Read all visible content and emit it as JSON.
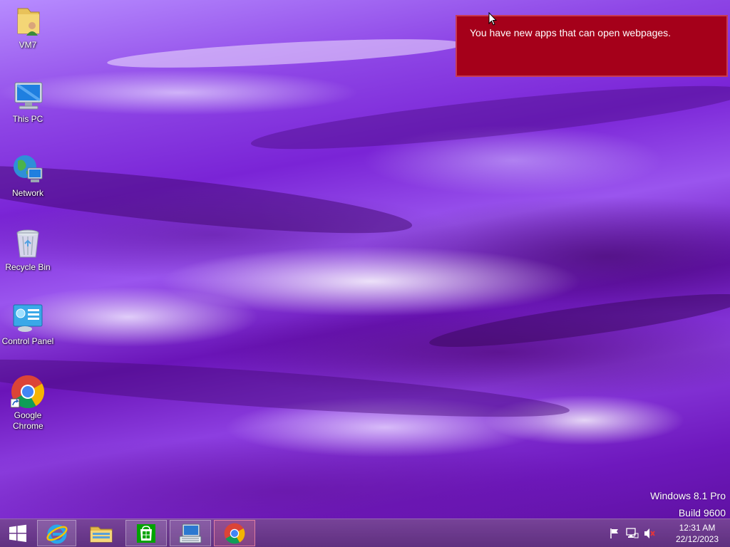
{
  "desktop": {
    "icons": [
      {
        "label": "VM7",
        "icon": "user-folder-icon"
      },
      {
        "label": "This PC",
        "icon": "this-pc-icon"
      },
      {
        "label": "Network",
        "icon": "network-icon"
      },
      {
        "label": "Recycle Bin",
        "icon": "recycle-bin-icon"
      },
      {
        "label": "Control Panel",
        "icon": "control-panel-icon"
      },
      {
        "label": "Google Chrome",
        "icon": "chrome-shortcut-icon"
      }
    ]
  },
  "notification": {
    "message": "You have new apps that can open webpages.",
    "background": "#a5001a"
  },
  "watermark": {
    "edition": "Windows 8.1 Pro",
    "build": "Build 9600"
  },
  "taskbar": {
    "start_icon": "windows-start-icon",
    "buttons": [
      {
        "name": "internet-explorer",
        "icon": "internet-explorer-icon"
      },
      {
        "name": "file-explorer",
        "icon": "file-explorer-icon"
      },
      {
        "name": "windows-store",
        "icon": "store-icon"
      },
      {
        "name": "on-screen-keyboard",
        "icon": "keyboard-monitor-icon"
      },
      {
        "name": "google-chrome",
        "icon": "chrome-icon"
      }
    ],
    "tray": {
      "icons": [
        "action-center-flag-icon",
        "network-status-icon",
        "volume-muted-icon"
      ],
      "time": "12:31 AM",
      "date": "22/12/2023"
    }
  }
}
